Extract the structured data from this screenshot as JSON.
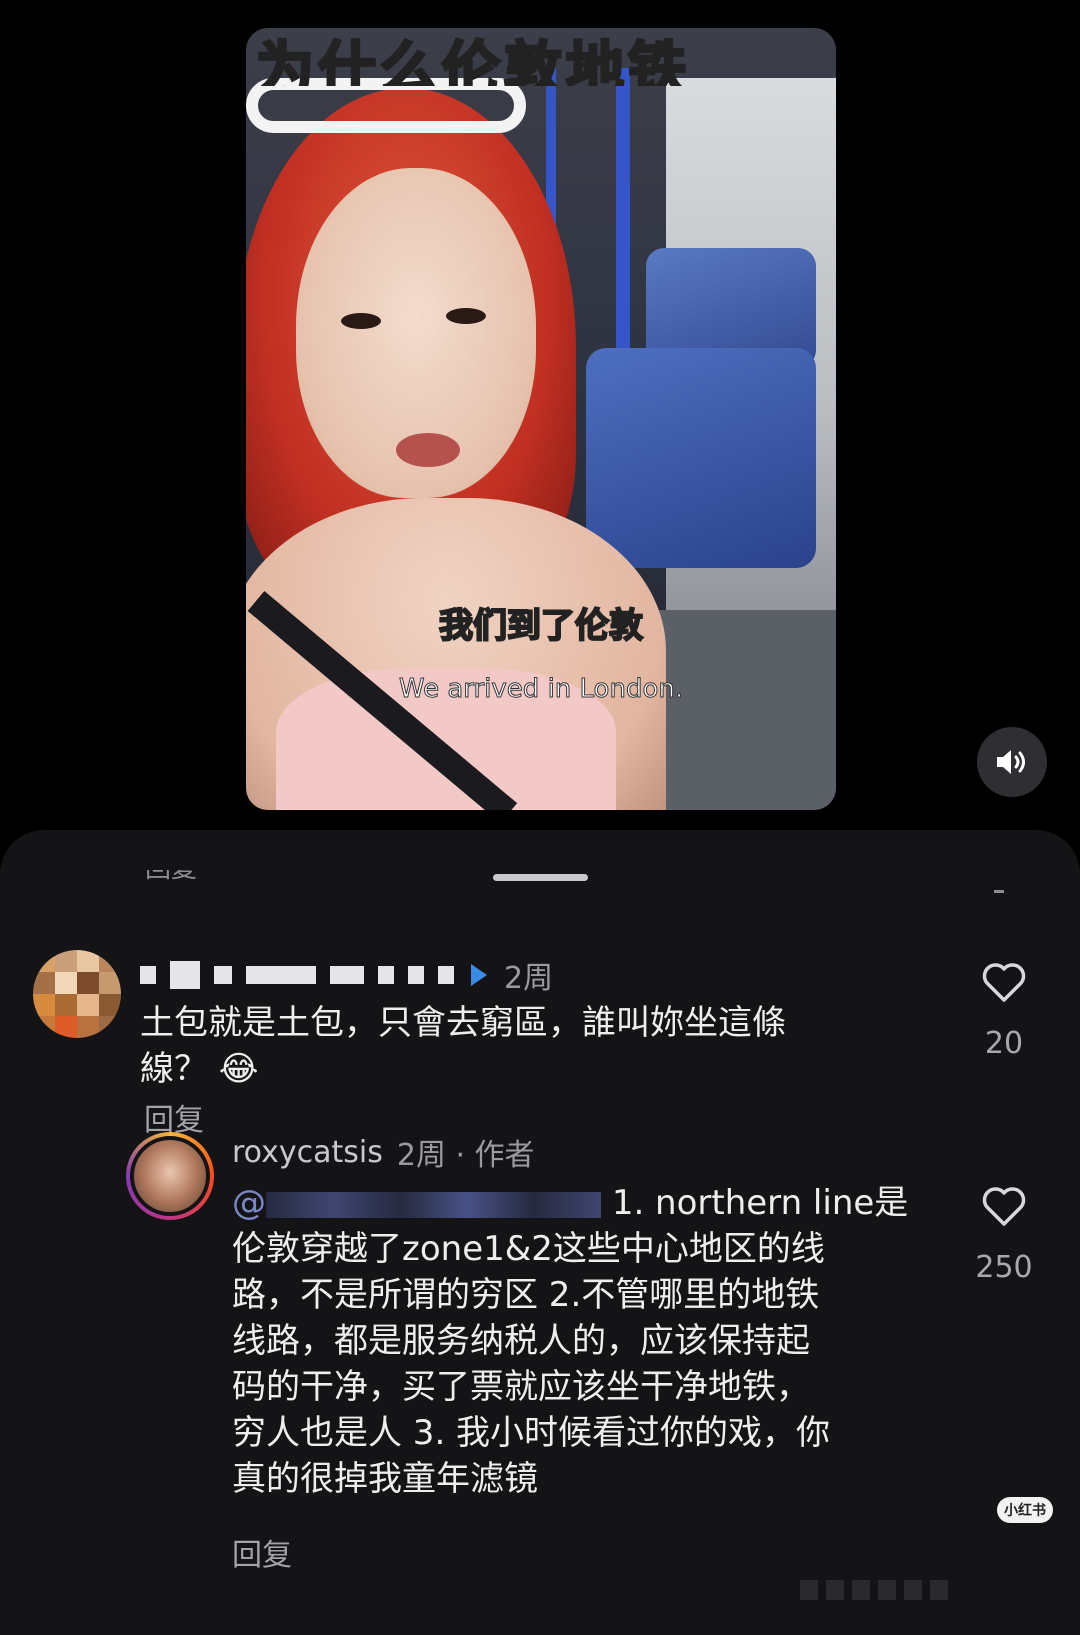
{
  "video": {
    "banner_text": "为什么伦敦地铁",
    "subtitle_cn": "我们到了伦敦",
    "subtitle_en": "We arrived in London."
  },
  "sheet": {
    "cut_label": "回复"
  },
  "comments": [
    {
      "username": "",
      "time": "2周",
      "text_line1": "土包就是土包，只會去窮區，誰叫妳坐這條",
      "text_line2": "線？ 😂",
      "reply_label": "回复",
      "like_count": "20"
    },
    {
      "username": "roxycatsis",
      "time": "2周 · 作者",
      "mention": "@",
      "text_lines": [
        "1. northern line是",
        "伦敦穿越了zone1&2这些中心地区的线",
        "路，不是所谓的穷区 2.不管哪里的地铁",
        "线路，都是服务纳税人的，应该保持起",
        "码的干净，买了票就应该坐干净地铁，",
        "穷人也是人 3. 我小时候看过你的戏，你",
        "真的很掉我童年滤镜"
      ],
      "reply_label": "回复",
      "like_count": "250"
    }
  ],
  "watermark": "小红书",
  "colors": {
    "sheet_bg": "#141416",
    "banner": "#ffd92a",
    "mention": "#7b88c9"
  },
  "icons": [
    "volume-icon",
    "heart-icon",
    "verified-icon",
    "chevron-down-icon"
  ]
}
